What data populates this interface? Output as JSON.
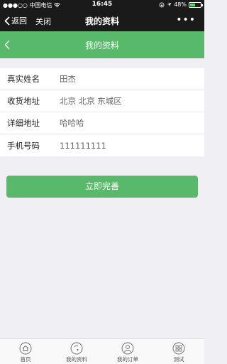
{
  "status_bar": {
    "carrier": "●●●○○ 中国电信",
    "time": "16:45",
    "battery": "48%",
    "battery_level": 0.48
  },
  "nav": {
    "back_label": "返回",
    "close_label": "关闭",
    "title": "我的资料",
    "more_label": "•••"
  },
  "header": {
    "title": "我的资料"
  },
  "form": {
    "rows": [
      {
        "label": "真实姓名",
        "value": "田杰"
      },
      {
        "label": "收货地址",
        "value": "北京 北京 东城区"
      },
      {
        "label": "详细地址",
        "value": "哈哈哈"
      },
      {
        "label": "手机号码",
        "value": "111111111"
      }
    ]
  },
  "submit_label": "立即完善",
  "tabs": [
    {
      "label": "首页",
      "icon": "home-icon"
    },
    {
      "label": "我的资料",
      "icon": "profile-icon"
    },
    {
      "label": "我的订单",
      "icon": "order-icon"
    },
    {
      "label": "测试",
      "icon": "grid-icon"
    }
  ],
  "colors": {
    "accent": "#58b96a",
    "nav_bg": "#1a1a1a",
    "page_bg": "#efeff4"
  }
}
